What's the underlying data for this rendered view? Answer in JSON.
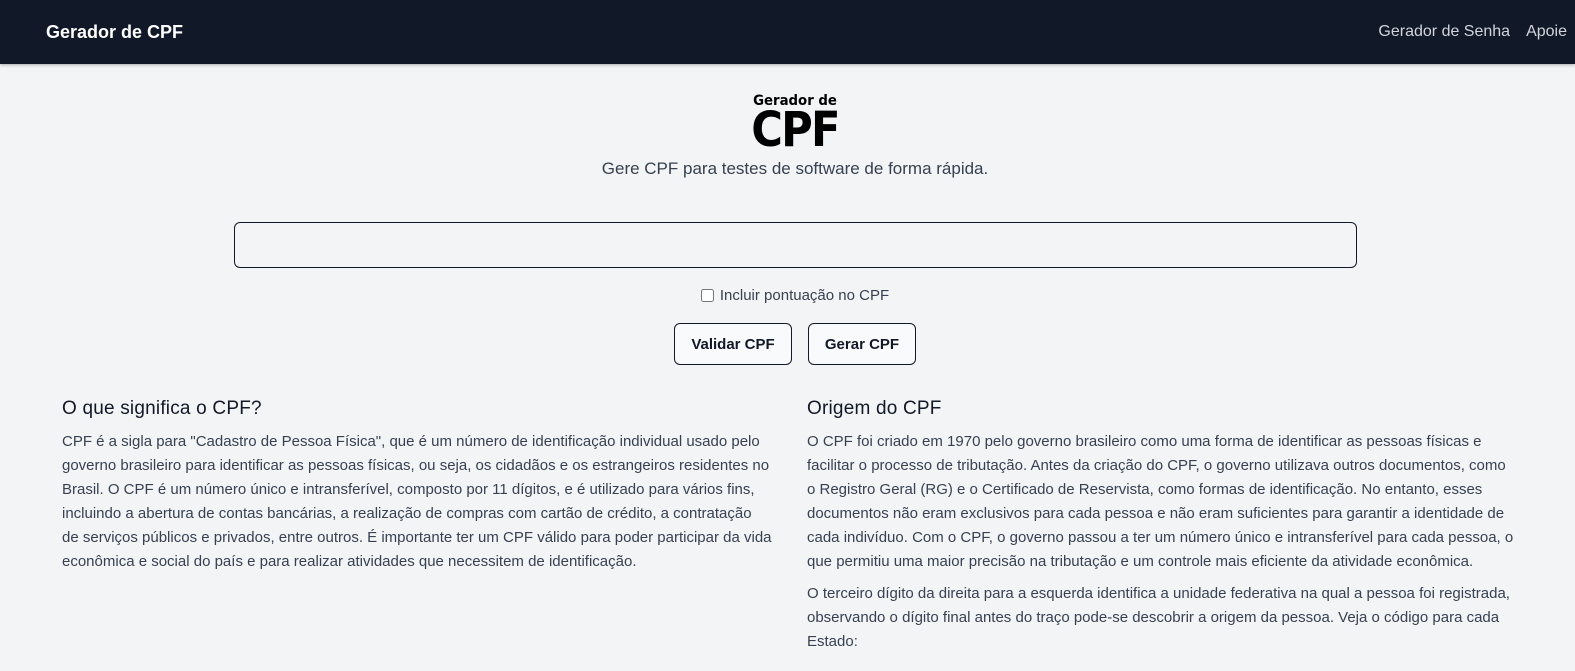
{
  "nav": {
    "brand": "Gerador de CPF",
    "links": [
      "Gerador de Senha",
      "Apoie"
    ]
  },
  "logo": {
    "small_text": "Gerador de",
    "big_text": "CPF"
  },
  "hero": {
    "tagline": "Gere CPF para testes de software de forma rápida."
  },
  "form": {
    "input_value": "",
    "checkbox_label": "Incluir pontuação no CPF",
    "validate_label": "Validar CPF",
    "generate_label": "Gerar CPF"
  },
  "sections": {
    "meaning": {
      "title": "O que significa o CPF?",
      "paragraph": "CPF é a sigla para \"Cadastro de Pessoa Física\", que é um número de identificação individual usado pelo governo brasileiro para identificar as pessoas físicas, ou seja, os cidadãos e os estrangeiros residentes no Brasil. O CPF é um número único e intransferível, composto por 11 dígitos, e é utilizado para vários fins, incluindo a abertura de contas bancárias, a realização de compras com cartão de crédito, a contratação de serviços públicos e privados, entre outros. É importante ter um CPF válido para poder participar da vida econômica e social do país e para realizar atividades que necessitem de identificação."
    },
    "origin": {
      "title": "Origem do CPF",
      "paragraph1": "O CPF foi criado em 1970 pelo governo brasileiro como uma forma de identificar as pessoas físicas e facilitar o processo de tributação. Antes da criação do CPF, o governo utilizava outros documentos, como o Registro Geral (RG) e o Certificado de Reservista, como formas de identificação. No entanto, esses documentos não eram exclusivos para cada pessoa e não eram suficientes para garantir a identidade de cada indivíduo. Com o CPF, o governo passou a ter um número único e intransferível para cada pessoa, o que permitiu uma maior precisão na tributação e um controle mais eficiente da atividade econômica.",
      "paragraph2": "O terceiro dígito da direita para a esquerda identifica a unidade federativa na qual a pessoa foi registrada, observando o dígito final antes do traço pode-se descobrir a origem da pessoa. Veja o código para cada Estado:"
    }
  },
  "colors": {
    "navbar_bg": "#111827",
    "page_bg": "#f3f4f6",
    "text_dark": "#111827",
    "text_body": "#374151"
  }
}
